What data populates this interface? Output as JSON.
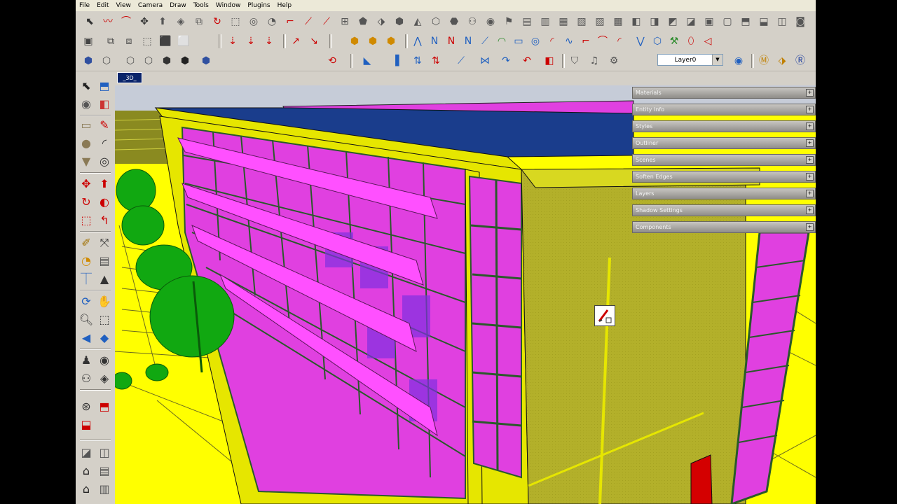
{
  "menu": [
    "File",
    "Edit",
    "View",
    "Camera",
    "Draw",
    "Tools",
    "Window",
    "Plugins",
    "Help"
  ],
  "toolbar": {
    "layer_value": "Layer0"
  },
  "scene_tab": "_3D_",
  "tray_panels": [
    "Materials",
    "Entity Info",
    "Styles",
    "Outliner",
    "Scenes",
    "Soften Edges",
    "Layers",
    "Shadow Settings",
    "Components"
  ],
  "colors": {
    "ground": "#ffff00",
    "wall": "#b4b428",
    "roof": "#1a3d8c",
    "glass": "#e040e0",
    "mullion": "#2a5a2a",
    "tree": "#11a811",
    "door": "#d40000"
  }
}
